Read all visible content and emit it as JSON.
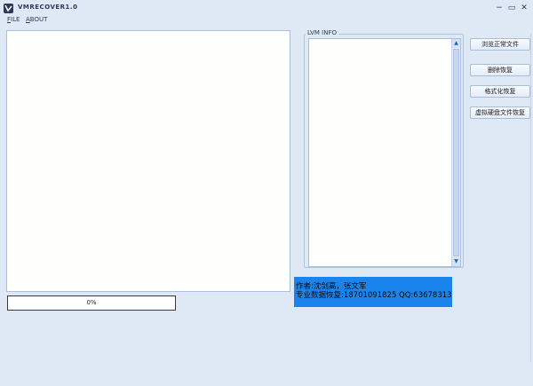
{
  "window": {
    "title": "VMRECOVER1.0",
    "minimize_glyph": "−",
    "maximize_glyph": "▭",
    "close_glyph": "✕"
  },
  "menu": {
    "items": [
      {
        "accel": "F",
        "rest": "ILE"
      },
      {
        "accel": "A",
        "rest": "BOUT"
      }
    ]
  },
  "progress": {
    "text": "0%",
    "value": 0
  },
  "lvm": {
    "label": "LVM INFO"
  },
  "info": {
    "line1": "作者:沈剑高，张文军",
    "line2": "专业数据恢复:18701091825  QQ:63678313"
  },
  "buttons": [
    {
      "label": "浏览正常文件"
    },
    {
      "label": "删除恢复"
    },
    {
      "label": "格式化恢复"
    },
    {
      "label": "虚拟硬盘文件恢复"
    }
  ],
  "colors": {
    "accent": "#1a84ec",
    "background": "#dfe9f6",
    "panel": "#fcfffc"
  },
  "icons": {
    "app": "app-icon"
  }
}
